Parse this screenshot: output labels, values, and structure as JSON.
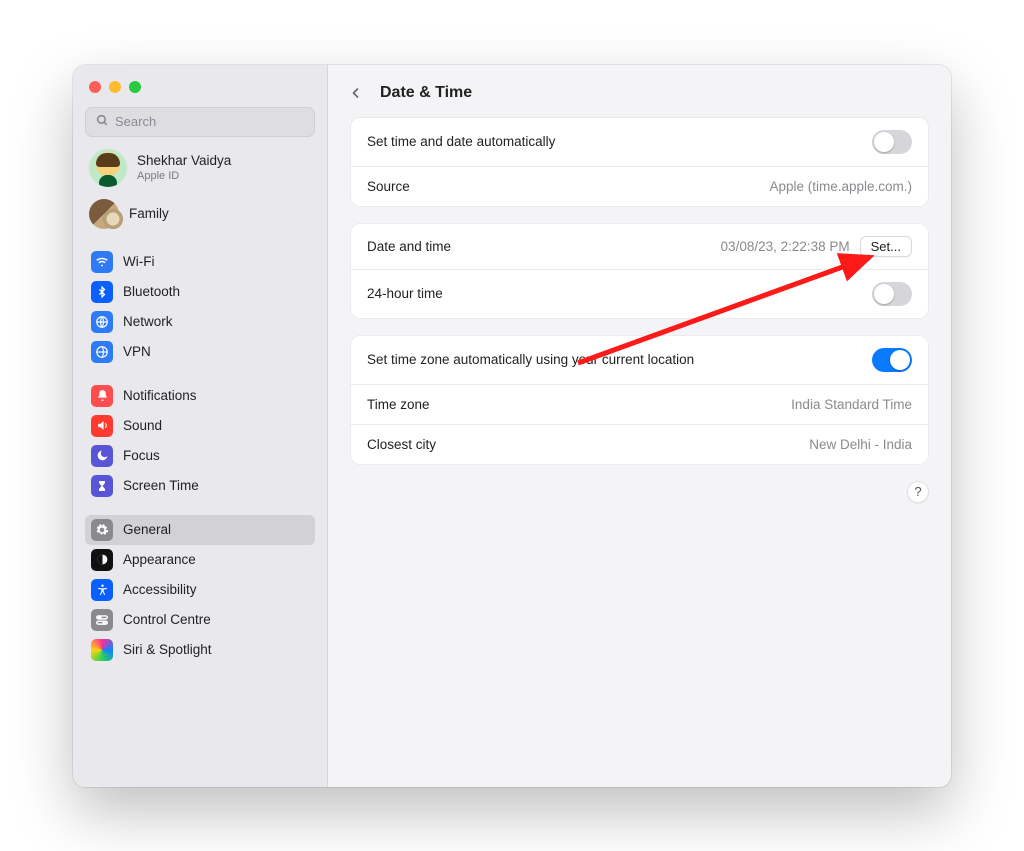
{
  "search": {
    "placeholder": "Search"
  },
  "user": {
    "name": "Shekhar Vaidya",
    "sub": "Apple ID"
  },
  "family": {
    "label": "Family"
  },
  "sidebar": {
    "items": [
      {
        "label": "Wi-Fi"
      },
      {
        "label": "Bluetooth"
      },
      {
        "label": "Network"
      },
      {
        "label": "VPN"
      },
      {
        "label": "Notifications"
      },
      {
        "label": "Sound"
      },
      {
        "label": "Focus"
      },
      {
        "label": "Screen Time"
      },
      {
        "label": "General"
      },
      {
        "label": "Appearance"
      },
      {
        "label": "Accessibility"
      },
      {
        "label": "Control Centre"
      },
      {
        "label": "Siri & Spotlight"
      }
    ]
  },
  "header": {
    "title": "Date & Time"
  },
  "rows": {
    "autoTime": "Set time and date automatically",
    "source": "Source",
    "sourceValue": "Apple (time.apple.com.)",
    "dateTime": "Date and time",
    "dateTimeValue": "03/08/23, 2:22:38 PM",
    "setLabel": "Set...",
    "h24": "24-hour time",
    "autoTZ": "Set time zone automatically using your current location",
    "tz": "Time zone",
    "tzValue": "India Standard Time",
    "city": "Closest city",
    "cityValue": "New Delhi - India"
  },
  "help": "?"
}
